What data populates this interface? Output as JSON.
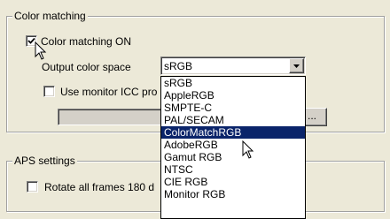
{
  "color_group": {
    "title": "Color matching",
    "color_matching_on": {
      "label": "Color matching ON",
      "checked": true
    },
    "output_color_space": {
      "label": "Output color space",
      "selected": "sRGB",
      "options": [
        "sRGB",
        "AppleRGB",
        "SMPTE-C",
        "PAL/SECAM",
        "ColorMatchRGB",
        "AdobeRGB",
        "Gamut RGB",
        "NTSC",
        "CIE RGB",
        "Monitor RGB"
      ],
      "highlighted": "ColorMatchRGB"
    },
    "use_monitor_icc": {
      "label": "Use monitor ICC pro",
      "checked": false
    },
    "profile_path": {
      "value": ""
    },
    "browse_button": {
      "label": "..."
    }
  },
  "aps_group": {
    "title": "APS settings",
    "rotate_frames": {
      "label": "Rotate all frames 180 d",
      "checked": false
    }
  },
  "icons": {
    "dropdown_arrow": "triangle-down-icon",
    "check": "check-icon",
    "pointer": "mouse-pointer-icon"
  }
}
